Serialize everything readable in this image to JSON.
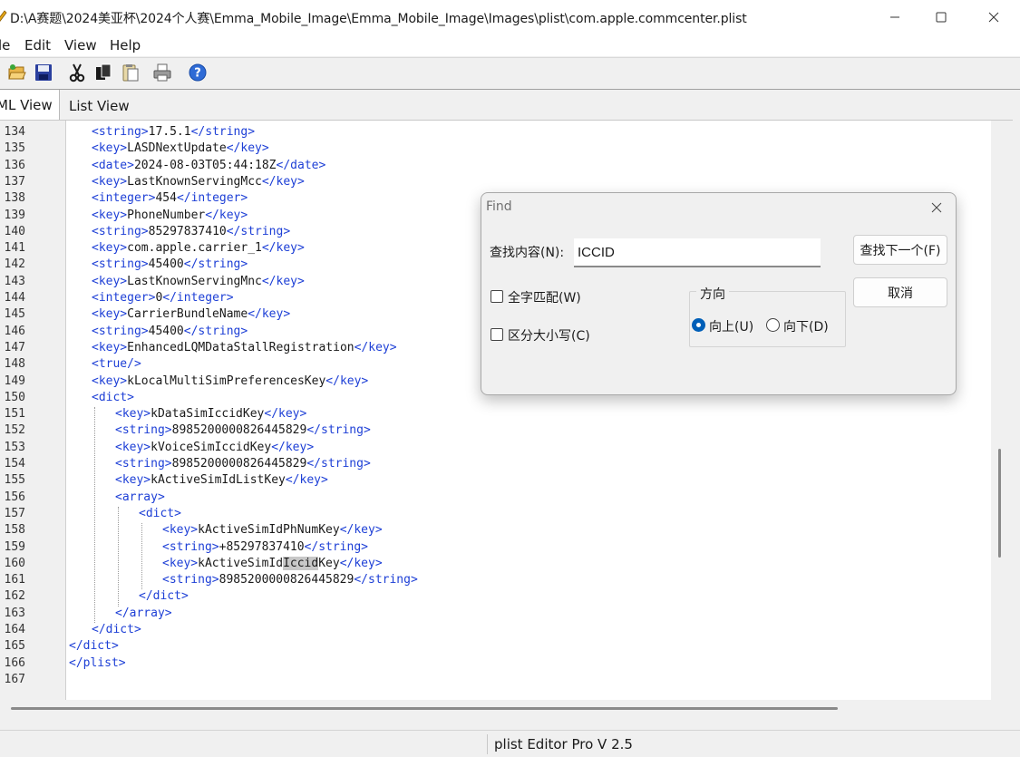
{
  "window": {
    "title": "D:\\A赛题\\2024美亚杯\\2024个人赛\\Emma_Mobile_Image\\Emma_Mobile_Image\\Images\\plist\\com.apple.commcenter.plist",
    "controls": {
      "minimize_icon": "minimize-icon",
      "maximize_icon": "maximize-icon",
      "close_icon": "close-icon"
    }
  },
  "menu": [
    "le",
    "Edit",
    "View",
    "Help"
  ],
  "toolbar": [
    "open-icon",
    "save-icon",
    "cut-icon",
    "copy-icon",
    "paste-icon",
    "print-icon",
    "help-icon"
  ],
  "tabs": [
    {
      "label": "XML View",
      "visible_label": "ML View",
      "active": true
    },
    {
      "label": "List View",
      "active": false
    }
  ],
  "editor": {
    "lines": [
      {
        "num": "134",
        "indent": 0,
        "text": "<string>17.5.1</string>"
      },
      {
        "num": "135",
        "indent": 0,
        "text": "<key>LASDNextUpdate</key>"
      },
      {
        "num": "136",
        "indent": 0,
        "text": "<date>2024-08-03T05:44:18Z</date>"
      },
      {
        "num": "137",
        "indent": 0,
        "text": "<key>LastKnownServingMcc</key>"
      },
      {
        "num": "138",
        "indent": 0,
        "text": "<integer>454</integer>"
      },
      {
        "num": "139",
        "indent": 0,
        "text": "<key>PhoneNumber</key>"
      },
      {
        "num": "140",
        "indent": 0,
        "text": "<string>85297837410</string>"
      },
      {
        "num": "141",
        "indent": 0,
        "text": "<key>com.apple.carrier_1</key>"
      },
      {
        "num": "142",
        "indent": 0,
        "text": "<string>45400</string>"
      },
      {
        "num": "143",
        "indent": 0,
        "text": "<key>LastKnownServingMnc</key>"
      },
      {
        "num": "144",
        "indent": 0,
        "text": "<integer>0</integer>"
      },
      {
        "num": "145",
        "indent": 0,
        "text": "<key>CarrierBundleName</key>"
      },
      {
        "num": "146",
        "indent": 0,
        "text": "<string>45400</string>"
      },
      {
        "num": "147",
        "indent": 0,
        "text": "<key>EnhancedLQMDataStallRegistration</key>"
      },
      {
        "num": "148",
        "indent": 0,
        "text": "<true/>"
      },
      {
        "num": "149",
        "indent": 0,
        "text": "<key>kLocalMultiSimPreferencesKey</key>"
      },
      {
        "num": "150",
        "indent": 0,
        "text": "<dict>"
      },
      {
        "num": "151",
        "indent": 1,
        "text": "<key>kDataSimIccidKey</key>"
      },
      {
        "num": "152",
        "indent": 1,
        "text": "<string>8985200000826445829</string>"
      },
      {
        "num": "153",
        "indent": 1,
        "text": "<key>kVoiceSimIccidKey</key>"
      },
      {
        "num": "154",
        "indent": 1,
        "text": "<string>8985200000826445829</string>"
      },
      {
        "num": "155",
        "indent": 1,
        "text": "<key>kActiveSimIdListKey</key>"
      },
      {
        "num": "156",
        "indent": 1,
        "text": "<array>"
      },
      {
        "num": "157",
        "indent": 2,
        "text": "<dict>"
      },
      {
        "num": "158",
        "indent": 3,
        "text": "<key>kActiveSimIdPhNumKey</key>"
      },
      {
        "num": "159",
        "indent": 3,
        "text": "<string>+85297837410</string>"
      },
      {
        "num": "160",
        "indent": 3,
        "text": "<key>kActiveSimIdIccidKey</key>",
        "highlight": "Iccid"
      },
      {
        "num": "161",
        "indent": 3,
        "text": "<string>8985200000826445829</string>"
      },
      {
        "num": "162",
        "indent": 2,
        "text": "</dict>"
      },
      {
        "num": "163",
        "indent": 1,
        "text": "</array>"
      },
      {
        "num": "164",
        "indent": 0,
        "text": "</dict>"
      },
      {
        "num": "165",
        "indent": -1,
        "text": "</dict>"
      },
      {
        "num": "166",
        "indent": -1,
        "text": "</plist>"
      },
      {
        "num": "167",
        "indent": -1,
        "text": ""
      }
    ]
  },
  "status": {
    "text": "plist Editor Pro V 2.5"
  },
  "find_dialog": {
    "title": "Find",
    "find_label": "查找内容(N):",
    "find_value": "ICCID",
    "find_next_label": "查找下一个(F)",
    "cancel_label": "取消",
    "whole_word_label": "全字匹配(W)",
    "whole_word_checked": false,
    "match_case_label": "区分大小写(C)",
    "match_case_checked": false,
    "direction_label": "方向",
    "direction_up_label": "向上(U)",
    "direction_down_label": "向下(D)",
    "direction": "up"
  }
}
